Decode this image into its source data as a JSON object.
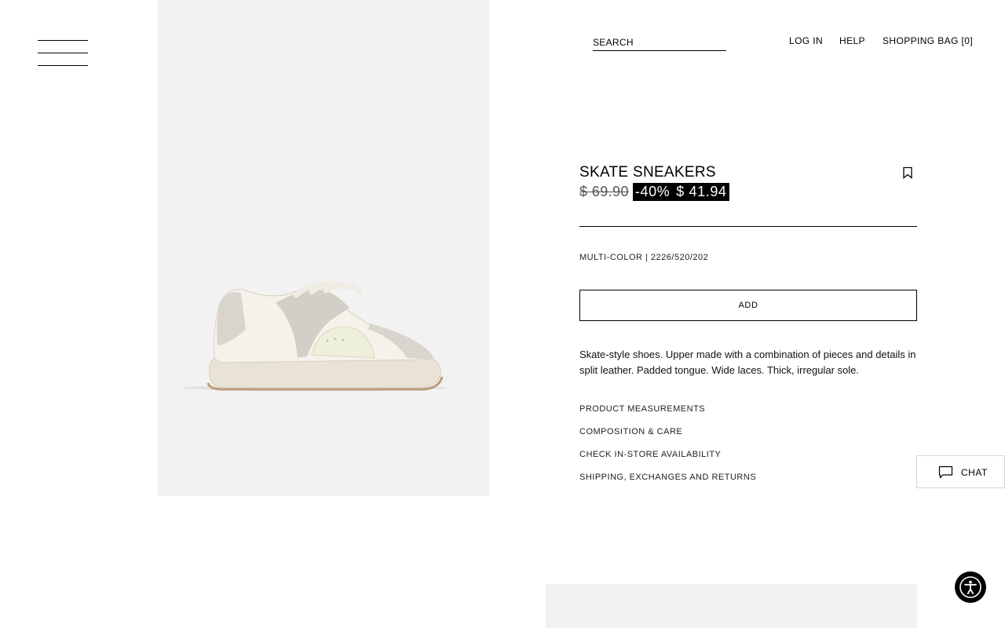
{
  "header": {
    "search_placeholder": "SEARCH",
    "nav": {
      "login": "LOG IN",
      "help": "HELP",
      "bag": "SHOPPING BAG [0]"
    }
  },
  "menu": {
    "icon": "hamburger-menu-icon"
  },
  "product": {
    "image_alt": "Skate sneakers in ecru and light grey",
    "title": "SKATE SNEAKERS",
    "bookmark_icon": "bookmark-icon",
    "original_price": "$ 69.90",
    "discount": "-40%",
    "sale_price": "$ 41.94",
    "color_ref": "MULTI-COLOR | 2226/520/202",
    "add_label": "ADD",
    "description": "Skate-style shoes. Upper made with a combination of pieces and details in split leather. Padded tongue. Wide laces. Thick, irregular sole.",
    "info_links": [
      "PRODUCT MEASUREMENTS",
      "COMPOSITION & CARE",
      "CHECK IN-STORE AVAILABILITY",
      "SHIPPING, EXCHANGES AND RETURNS"
    ]
  },
  "chat": {
    "icon": "chat-bubble-icon",
    "label": "CHAT"
  },
  "accessibility": {
    "icon": "accessibility-icon"
  },
  "colors": {
    "background": "#ffffff",
    "image_bg": "#f2f2f2",
    "text": "#000000",
    "sale_bg": "#000000",
    "sale_text": "#ffffff"
  }
}
